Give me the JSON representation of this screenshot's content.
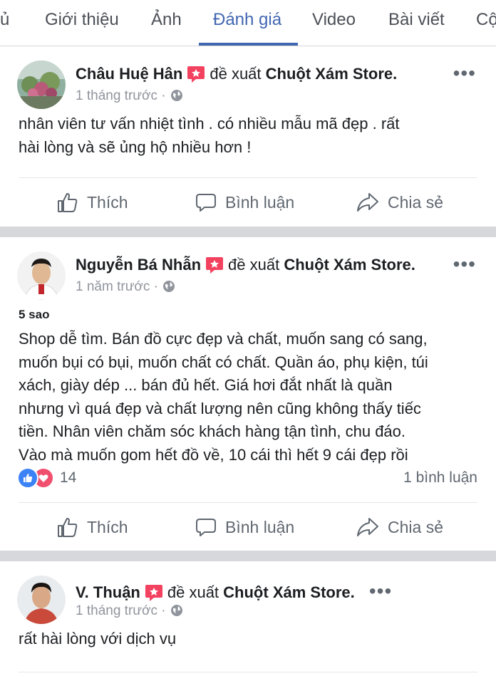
{
  "tabs": [
    {
      "label": "ủ"
    },
    {
      "label": "Giới thiệu"
    },
    {
      "label": "Ảnh"
    },
    {
      "label": "Đánh giá",
      "active": true
    },
    {
      "label": "Video"
    },
    {
      "label": "Bài viết"
    },
    {
      "label": "Cộ"
    }
  ],
  "posts": [
    {
      "author": "Châu Huệ Hân",
      "verb": "đề xuất",
      "page": "Chuột Xám Store.",
      "time": "1 tháng trước ·",
      "text": "nhân viên tư vấn nhiệt tình . có nhiều mẫu mã đẹp . rất\nhài lòng và sẽ ủng hộ nhiều hơn !",
      "actions": {
        "like": "Thích",
        "comment": "Bình luận",
        "share": "Chia sẻ"
      }
    },
    {
      "author": "Nguyễn Bá Nhẫn",
      "verb": "đề xuất",
      "page": "Chuột Xám Store.",
      "time": "1 năm trước ·",
      "rating": "5 sao",
      "text": "Shop dễ tìm. Bán đồ cực đẹp và chất, muốn sang có sang,\nmuốn bụi có bụi, muốn chất có chất. Quần áo, phụ kiện, túi\nxách, giày dép ... bán đủ hết. Giá hơi đắt nhất là quần\nnhưng vì quá đẹp và chất lượng nên cũng không thấy tiếc\ntiền. Nhân viên chăm sóc khách hàng tận tình, chu đáo.\nVào mà muốn gom hết đồ về, 10 cái thì hết 9 cái đẹp rồi",
      "reaction_count": "14",
      "comment_count": "1 bình luận",
      "actions": {
        "like": "Thích",
        "comment": "Bình luận",
        "share": "Chia sẻ"
      }
    },
    {
      "author": "V. Thuận",
      "verb": "đề xuất",
      "page": "Chuột Xám Store.",
      "time": "1 tháng trước ·",
      "text": "rất hài lòng với dịch vụ"
    }
  ],
  "more_label": "•••",
  "colors": {
    "accent": "#4267b2",
    "recommend_badge": "#f3425f",
    "like_blue": "#3b82f6",
    "love_red": "#f0506e"
  },
  "icons": [
    "recommend-badge-icon",
    "globe-icon",
    "more-options-icon",
    "like-thumb-icon",
    "comment-bubble-icon",
    "share-arrow-icon"
  ]
}
